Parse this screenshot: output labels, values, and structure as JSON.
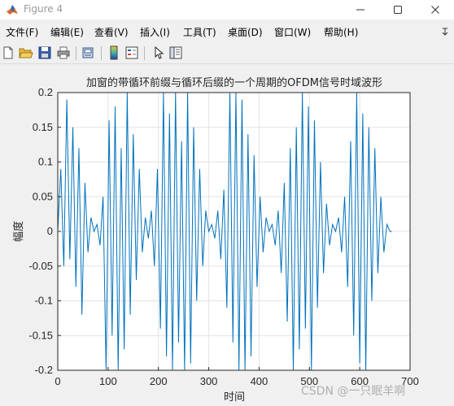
{
  "window": {
    "title": "Figure 4"
  },
  "menu": {
    "items": [
      "文件(F)",
      "编辑(E)",
      "查看(V)",
      "插入(I)",
      "工具(T)",
      "桌面(D)",
      "窗口(W)",
      "帮助(H)"
    ]
  },
  "toolbar": {
    "icons": [
      "new-file-icon",
      "open-file-icon",
      "save-icon",
      "print-icon",
      "link-figure-icon",
      "insert-colorbar-icon",
      "insert-legend-icon",
      "edit-plot-icon",
      "property-inspector-icon"
    ]
  },
  "watermark": "CSDN @一只眠羊啊",
  "chart_data": {
    "type": "line",
    "title": "加窗的带循环前缀与循环后缀的一个周期的OFDM信号时域波形",
    "xlabel": "时间",
    "ylabel": "幅度",
    "xlim": [
      0,
      700
    ],
    "ylim": [
      -0.2,
      0.2
    ],
    "xticks": [
      "0",
      "100",
      "200",
      "300",
      "400",
      "500",
      "600",
      "700"
    ],
    "yticks": [
      "0.2",
      "0.15",
      "0.1",
      "0.05",
      "0",
      "-0.05",
      "-0.1",
      "-0.15",
      "-0.2"
    ],
    "grid": true,
    "color": "#0072bd",
    "series": [
      {
        "x": [
          0,
          6,
          12,
          18,
          24,
          30,
          36,
          42,
          48,
          54,
          60,
          66,
          72,
          78,
          84,
          90,
          96,
          102,
          108,
          114,
          120,
          126,
          132,
          138,
          144,
          150,
          156,
          162,
          168,
          174,
          180,
          186,
          192,
          198,
          204,
          210,
          216,
          222,
          228,
          234,
          240,
          246,
          252,
          258,
          264,
          270,
          276,
          282,
          288,
          294,
          300,
          306,
          312,
          318,
          324,
          330,
          336,
          342,
          348,
          354,
          360,
          366,
          372,
          378,
          384,
          390,
          396,
          402,
          408,
          414,
          420,
          426,
          432,
          438,
          444,
          450,
          456,
          462,
          468,
          474,
          480,
          486,
          492,
          498,
          504,
          510,
          516,
          522,
          528,
          534,
          540,
          546,
          552,
          558,
          564,
          570,
          576,
          582,
          588,
          594,
          600,
          606,
          612,
          618,
          624,
          630,
          636,
          642,
          648,
          654,
          660,
          664
        ],
        "values": [
          0.0,
          0.09,
          -0.05,
          0.19,
          -0.04,
          0.15,
          -0.08,
          0.12,
          -0.12,
          0.07,
          -0.03,
          0.02,
          0.0,
          0.01,
          -0.02,
          0.05,
          -0.2,
          0.16,
          -0.15,
          0.18,
          -0.2,
          0.12,
          -0.17,
          0.2,
          -0.12,
          0.14,
          -0.07,
          0.09,
          -0.03,
          0.02,
          -0.01,
          0.03,
          -0.05,
          0.09,
          -0.14,
          0.2,
          -0.18,
          0.17,
          -0.2,
          0.2,
          -0.16,
          0.13,
          -0.2,
          0.2,
          -0.19,
          0.15,
          -0.1,
          0.09,
          -0.05,
          0.03,
          0.0,
          0.01,
          -0.01,
          0.03,
          -0.04,
          0.06,
          -0.11,
          0.2,
          -0.16,
          0.2,
          -0.2,
          0.19,
          -0.2,
          0.14,
          -0.18,
          0.11,
          -0.08,
          0.05,
          -0.03,
          0.02,
          0.0,
          0.01,
          -0.02,
          0.03,
          -0.06,
          0.07,
          -0.13,
          0.12,
          -0.2,
          0.15,
          -0.17,
          0.2,
          -0.14,
          0.18,
          -0.2,
          0.16,
          -0.11,
          0.1,
          -0.06,
          0.04,
          -0.02,
          0.01,
          0.0,
          0.02,
          -0.03,
          0.05,
          -0.08,
          0.13,
          -0.15,
          0.2,
          -0.19,
          0.17,
          -0.2,
          0.15,
          -0.1,
          0.12,
          -0.06,
          0.05,
          -0.03,
          0.01,
          0.0,
          0.0
        ]
      }
    ]
  }
}
